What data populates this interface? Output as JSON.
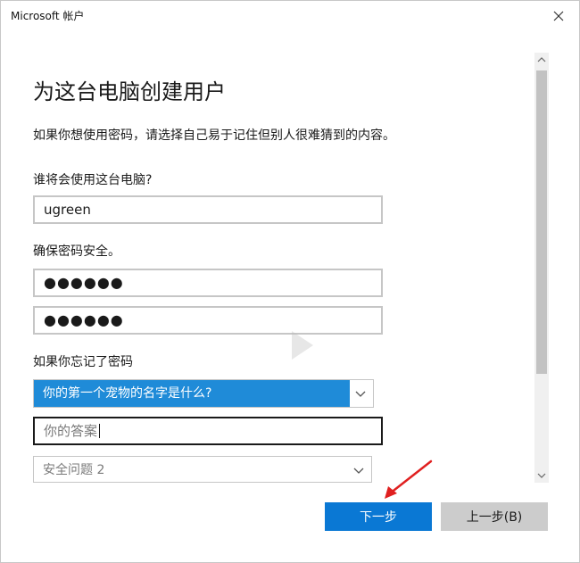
{
  "window": {
    "title": "Microsoft 帐户"
  },
  "form": {
    "heading": "为这台电脑创建用户",
    "description": "如果你想使用密码，请选择自己易于记住但别人很难猜到的内容。",
    "username_label": "谁将会使用这台电脑?",
    "username_value": "ugreen",
    "password_label": "确保密码安全。",
    "password_value": "●●●●●●",
    "password_confirm_value": "●●●●●●",
    "forgot_label": "如果你忘记了密码",
    "security_question_1": "你的第一个宠物的名字是什么?",
    "answer_placeholder": "你的答案",
    "security_question_2_placeholder": "安全问题 2"
  },
  "buttons": {
    "next": "下一步",
    "back": "上一步(B)"
  },
  "icons": {
    "close": "close-icon",
    "chevron": "chevron-down-icon",
    "scroll_up": "scroll-up-icon",
    "scroll_down": "scroll-down-icon",
    "arrow": "red-arrow-annotation"
  },
  "colors": {
    "accent": "#0a78d4",
    "select_highlight": "#1f8bd8",
    "annotation": "#e02020"
  }
}
